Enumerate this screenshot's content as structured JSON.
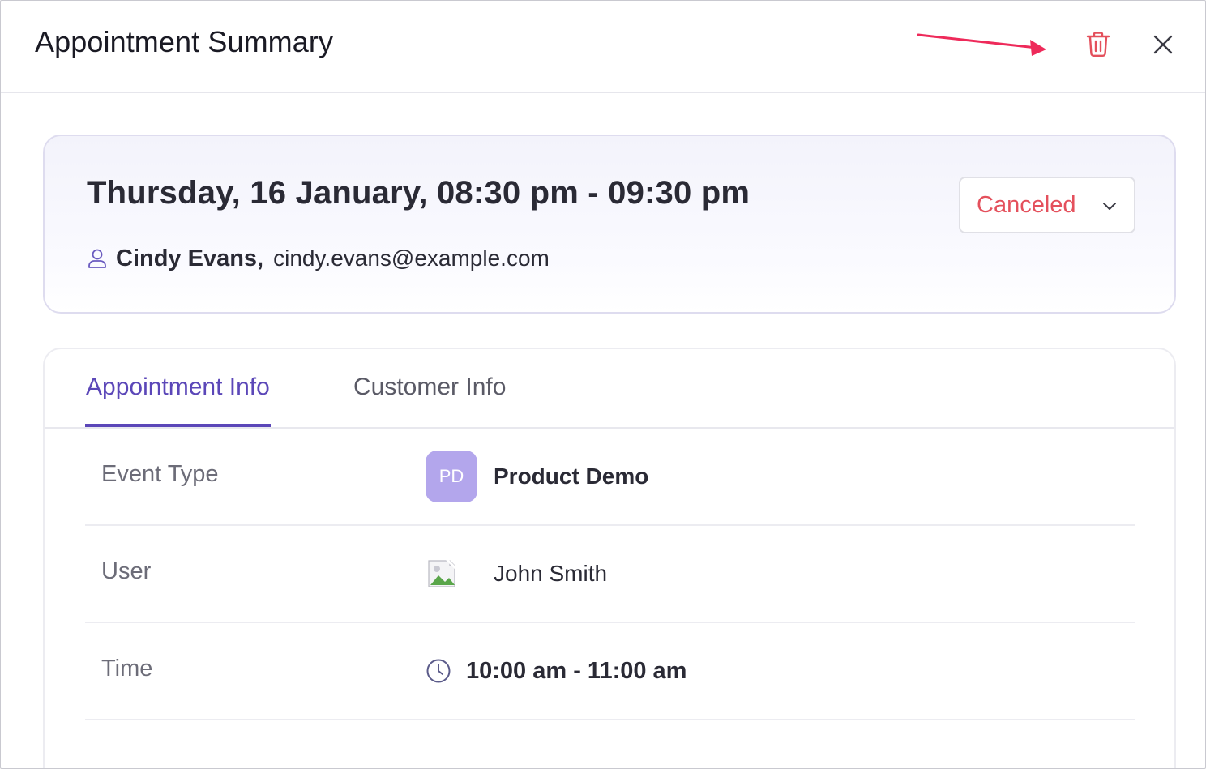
{
  "header": {
    "title": "Appointment Summary",
    "delete_icon": "trash-icon",
    "close_icon": "close-icon",
    "annotation_color": "#ee2a5a"
  },
  "summary": {
    "datetime": "Thursday, 16 January, 08:30 pm - 09:30 pm",
    "contact_name": "Cindy Evans,",
    "contact_email": "cindy.evans@example.com",
    "status": "Canceled",
    "status_color": "#e4505c"
  },
  "tabs": [
    {
      "label": "Appointment Info",
      "active": true
    },
    {
      "label": "Customer Info",
      "active": false
    }
  ],
  "rows": {
    "event_type": {
      "label": "Event Type",
      "initials": "PD",
      "value": "Product Demo"
    },
    "user": {
      "label": "User",
      "value": "John Smith"
    },
    "time": {
      "label": "Time",
      "value": "10:00 am - 11:00 am"
    }
  },
  "colors": {
    "accent": "#5b47b8",
    "avatar": "#b3a6ec",
    "danger": "#e4505c"
  }
}
